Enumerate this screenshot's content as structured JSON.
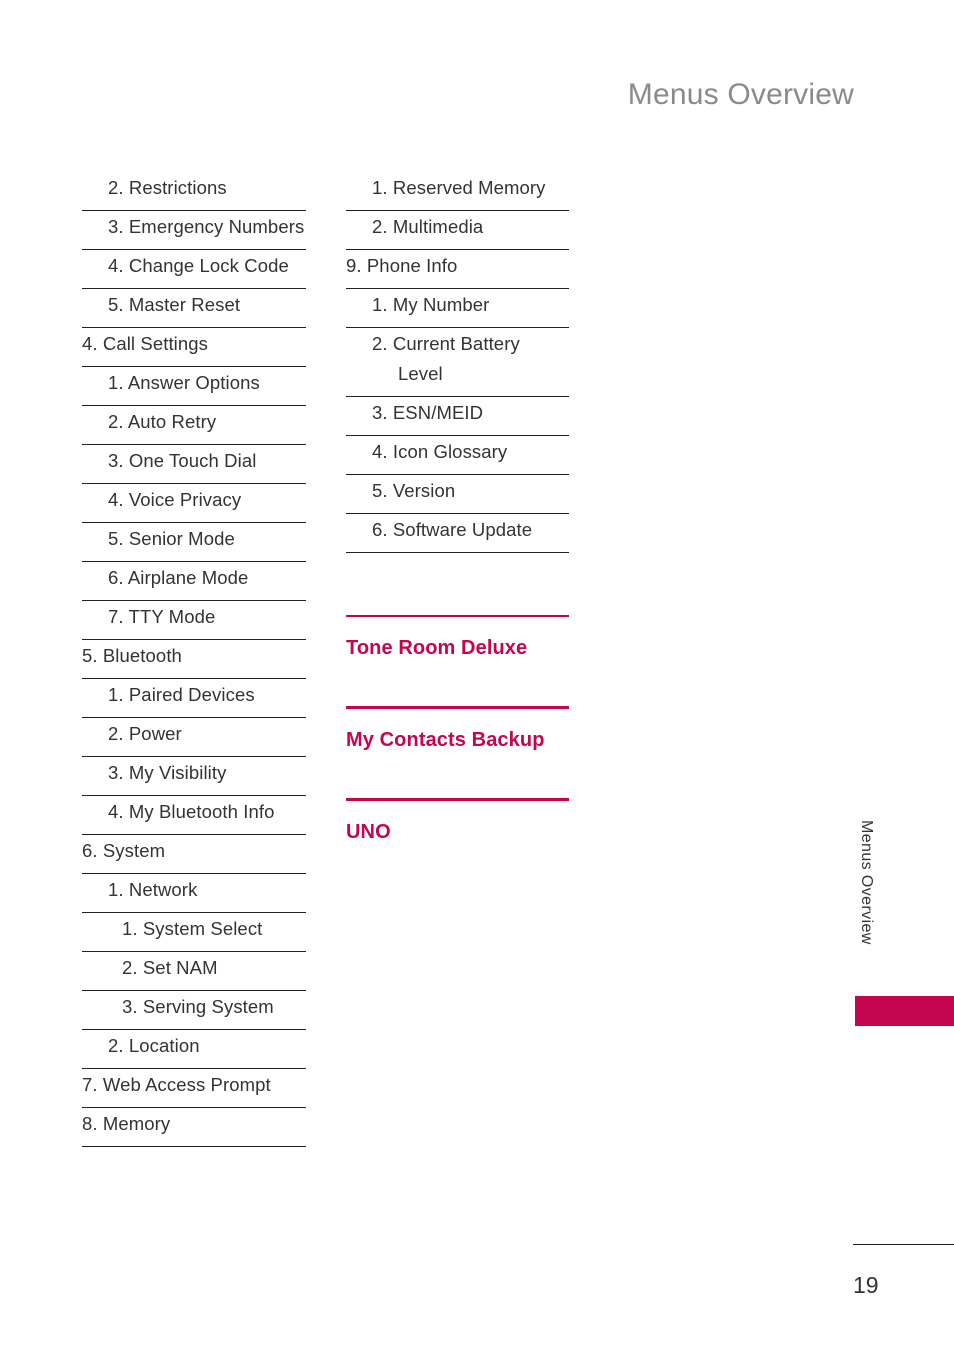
{
  "header": {
    "title": "Menus Overview"
  },
  "columns": {
    "left": [
      {
        "level": 2,
        "label": "2. Restrictions",
        "wrap": false
      },
      {
        "level": 2,
        "label": "3. Emergency Numbers",
        "wrap": true
      },
      {
        "level": 2,
        "label": "4. Change Lock Code",
        "wrap": true
      },
      {
        "level": 2,
        "label": "5. Master Reset",
        "wrap": false
      },
      {
        "level": 1,
        "label": "4. Call Settings",
        "wrap": false
      },
      {
        "level": 2,
        "label": "1. Answer Options",
        "wrap": false
      },
      {
        "level": 2,
        "label": "2. Auto Retry",
        "wrap": false
      },
      {
        "level": 2,
        "label": "3. One Touch Dial",
        "wrap": false
      },
      {
        "level": 2,
        "label": "4. Voice Privacy",
        "wrap": false
      },
      {
        "level": 2,
        "label": "5. Senior Mode",
        "wrap": false
      },
      {
        "level": 2,
        "label": "6. Airplane Mode",
        "wrap": false
      },
      {
        "level": 2,
        "label": "7. TTY Mode",
        "wrap": false
      },
      {
        "level": 1,
        "label": "5. Bluetooth",
        "wrap": false
      },
      {
        "level": 2,
        "label": "1. Paired Devices",
        "wrap": false
      },
      {
        "level": 2,
        "label": "2. Power",
        "wrap": false
      },
      {
        "level": 2,
        "label": "3. My Visibility",
        "wrap": false
      },
      {
        "level": 2,
        "label": "4. My Bluetooth Info",
        "wrap": false
      },
      {
        "level": 1,
        "label": "6. System",
        "wrap": false
      },
      {
        "level": 2,
        "label": "1. Network",
        "wrap": false
      },
      {
        "level": 3,
        "label": "1. System Select",
        "wrap": false
      },
      {
        "level": 3,
        "label": "2. Set NAM",
        "wrap": false
      },
      {
        "level": 3,
        "label": "3. Serving System",
        "wrap": false
      },
      {
        "level": 2,
        "label": "2. Location",
        "wrap": false
      },
      {
        "level": 1,
        "label": "7.  Web Access Prompt",
        "wrap": false
      },
      {
        "level": 1,
        "label": "8.   Memory",
        "wrap": false
      }
    ],
    "right": [
      {
        "level": 2,
        "label": "1. Reserved Memory",
        "wrap": true
      },
      {
        "level": 2,
        "label": "2. Multimedia",
        "wrap": false
      },
      {
        "level": 1,
        "label": "9. Phone Info",
        "wrap": false
      },
      {
        "level": 2,
        "label": "1. My Number",
        "wrap": false
      },
      {
        "level": 2,
        "label": "2. Current Battery Level",
        "wrap": true
      },
      {
        "level": 2,
        "label": "3. ESN/MEID",
        "wrap": false
      },
      {
        "level": 2,
        "label": "4. Icon Glossary",
        "wrap": false
      },
      {
        "level": 2,
        "label": "5. Version",
        "wrap": false
      },
      {
        "level": 2,
        "label": "6. Software Update",
        "wrap": false
      }
    ]
  },
  "sections": [
    {
      "title": "Tone Room Deluxe",
      "rule": "thin"
    },
    {
      "title": "My Contacts Backup",
      "rule": "thick"
    },
    {
      "title": "UNO",
      "rule": "thick"
    }
  ],
  "side_tab": {
    "label": "Menus Overview"
  },
  "footer": {
    "page_number": "19"
  },
  "colors": {
    "accent": "#c50550",
    "text": "#333335",
    "header": "#8a8a8e",
    "rule": "#231f20"
  }
}
